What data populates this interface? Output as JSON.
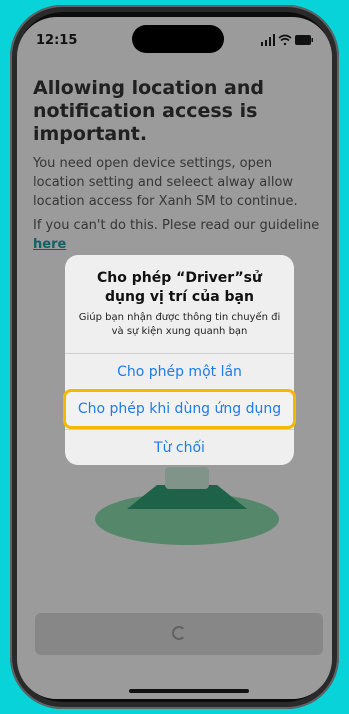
{
  "status_bar": {
    "time": "12:15"
  },
  "page": {
    "title": "Allowing location and notification access is important.",
    "description": "You need open device settings, open location setting and seleect  alway allow location access for Xanh SM to continue.",
    "guide_text": "If you can't do this. Plese read our guideline",
    "guide_link": "here"
  },
  "alert": {
    "title": "Cho phép “Driver”sử dụng vị trí của bạn",
    "message": "Giúp bạn nhận được thông tin chuyến đi và sự kiện xung quanh bạn",
    "buttons": {
      "allow_once": "Cho phép một lần",
      "allow_while_using": "Cho phép khi dùng ứng dụng",
      "deny": "Từ chối"
    }
  },
  "colors": {
    "background": "#08d3d8",
    "link": "#1a9a9e",
    "alert_button": "#1e7ce8",
    "highlight": "#f5b800"
  }
}
